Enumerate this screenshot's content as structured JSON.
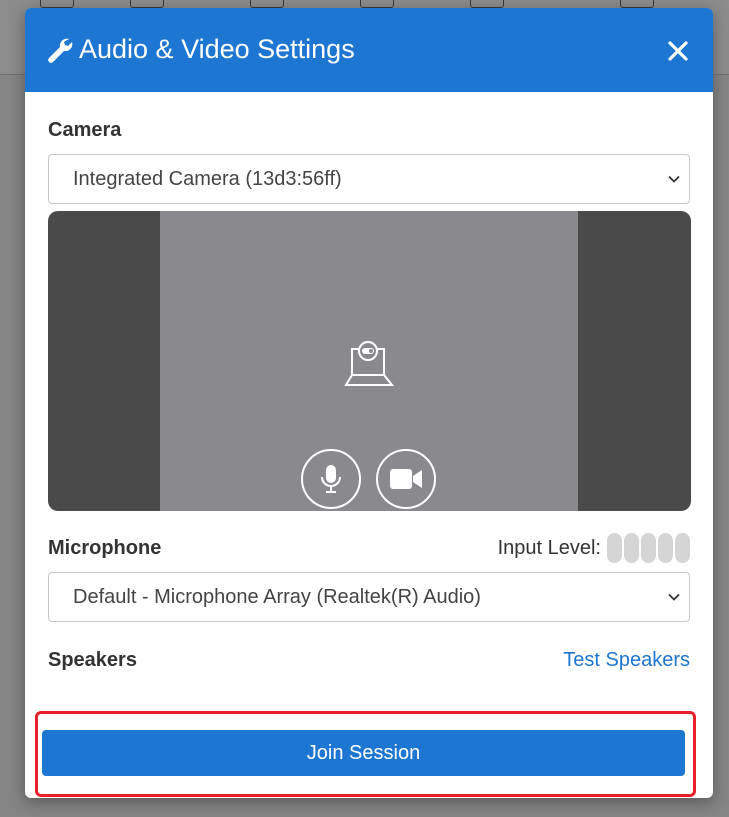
{
  "dialog": {
    "title": "Audio & Video Settings",
    "close_icon": "close-icon",
    "header_color": "#1c76d2"
  },
  "camera": {
    "label": "Camera",
    "selected": "Integrated Camera (13d3:56ff)",
    "placeholder_icon": "camera-off-icon",
    "mic_toggle_icon": "microphone-icon",
    "video_toggle_icon": "video-camera-icon"
  },
  "microphone": {
    "label": "Microphone",
    "input_level_label": "Input Level:",
    "input_level_bars": 5,
    "input_level_active": 0,
    "selected": "Default - Microphone Array (Realtek(R) Audio)"
  },
  "speakers": {
    "label": "Speakers",
    "test_link": "Test Speakers"
  },
  "actions": {
    "join_label": "Join Session",
    "highlight_color": "#e8202a"
  }
}
